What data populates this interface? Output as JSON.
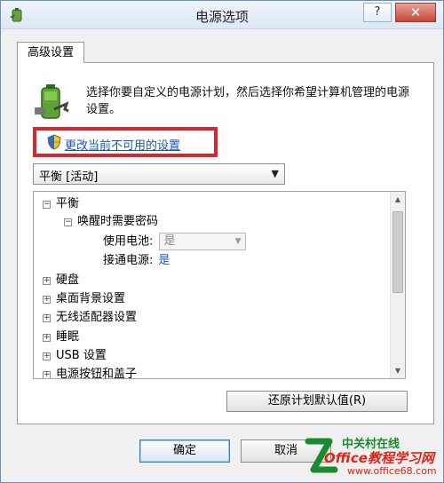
{
  "window": {
    "title": "电源选项",
    "help_label": "?",
    "close_label": "✕"
  },
  "tabs": [
    {
      "label": "高级设置"
    }
  ],
  "description": "选择你要自定义的电源计划，然后选择你希望计算机管理的电源设置。",
  "change_link": "更改当前不可用的设置",
  "plan_select": {
    "value": "平衡 [活动]",
    "arrow": "▼"
  },
  "tree": {
    "root": "平衡",
    "wakeup": {
      "label": "唤醒时需要密码",
      "battery_label": "使用电池:",
      "battery_value": "是",
      "ac_label": "接通电源:",
      "ac_value": "是"
    },
    "items": [
      "硬盘",
      "桌面背景设置",
      "无线适配器设置",
      "睡眠",
      "USB 设置",
      "电源按钮和盖子"
    ],
    "expanded_symbol": "−",
    "collapsed_symbol": "+"
  },
  "buttons": {
    "restore": "还原计划默认值(R)",
    "ok": "确定",
    "cancel": "取消"
  },
  "watermark": {
    "line1": "中关村在线",
    "line2": "Office教程学习网",
    "line3": "www.office68.com"
  },
  "colors": {
    "highlight": "#d9262e",
    "link": "#1a56b6"
  }
}
